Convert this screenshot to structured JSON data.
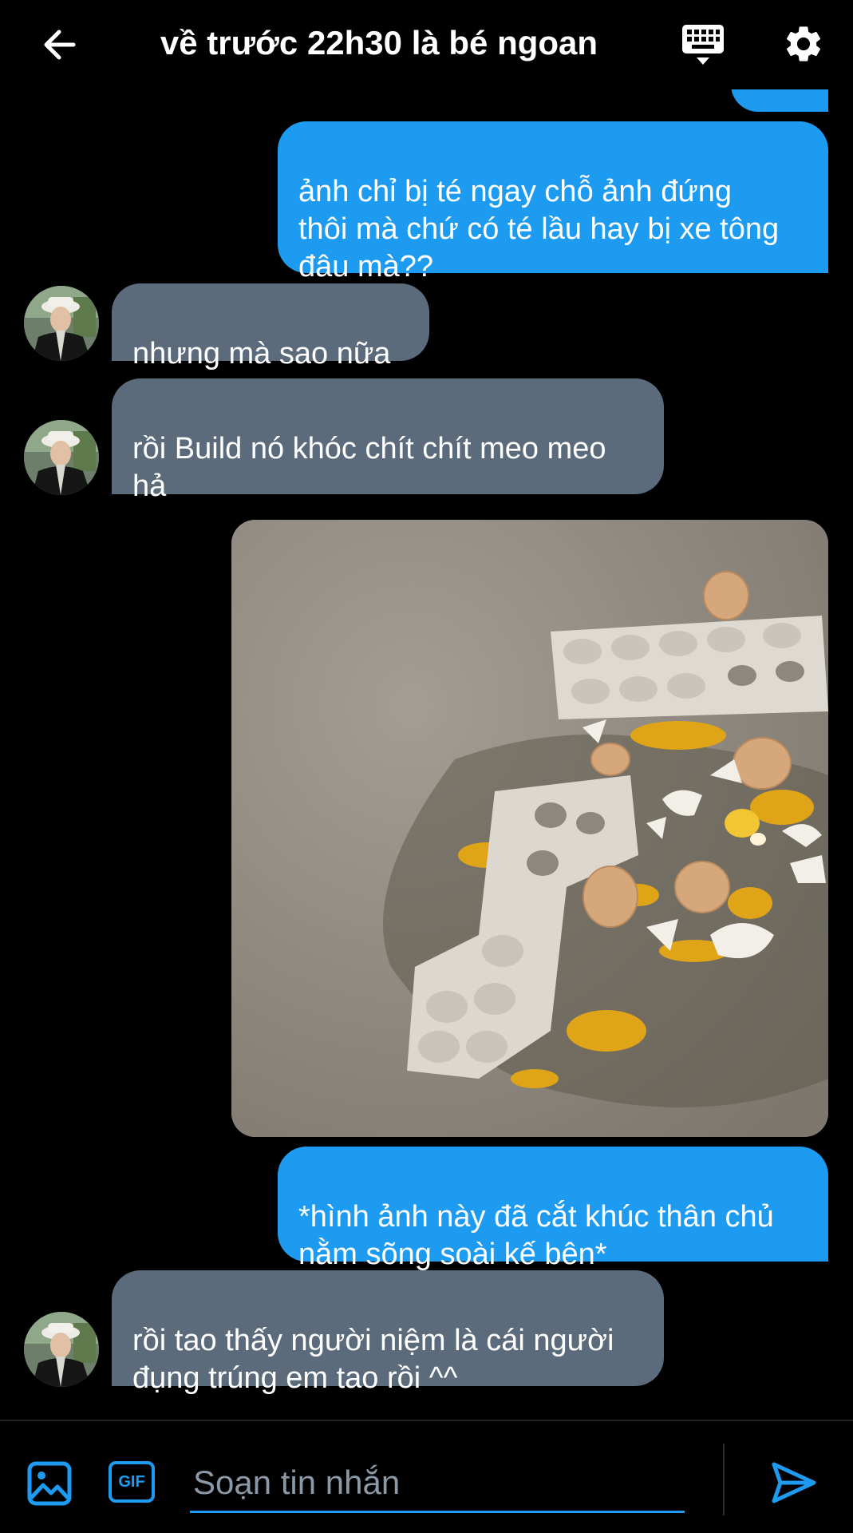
{
  "header": {
    "title": "về trước 22h30 là bé ngoan",
    "back_icon": "arrow-left-icon",
    "keyboard_icon": "keyboard-icon",
    "settings_icon": "gear-icon"
  },
  "messages": [
    {
      "type": "sent",
      "text": ""
    },
    {
      "type": "sent",
      "text": "ảnh chỉ bị té ngay chỗ ảnh đứng\nthôi mà chứ có té lầu hay bị xe tông\nđâu mà??"
    },
    {
      "type": "received",
      "text": "nhưng mà sao nữa"
    },
    {
      "type": "received",
      "text": "rồi Build nó khóc chít chít meo meo\nhả"
    },
    {
      "type": "sent-image",
      "text": ""
    },
    {
      "type": "sent",
      "text": "*hình ảnh này đã cắt khúc thân chủ\nnằm sõng soài kế bên*"
    },
    {
      "type": "received",
      "text": "rồi tao thấy người niệm là cái người\nđụng trúng em tao rồi ^^"
    }
  ],
  "composer": {
    "placeholder": "Soạn tin nhắn",
    "value": "",
    "gif_label": "GIF",
    "image_icon": "image-icon",
    "send_icon": "send-icon"
  },
  "colors": {
    "background": "#000000",
    "sent_bubble": "#1d9bf0",
    "received_bubble": "#5b6b7b",
    "accent": "#1d9bf0",
    "placeholder": "#8b98a5"
  }
}
